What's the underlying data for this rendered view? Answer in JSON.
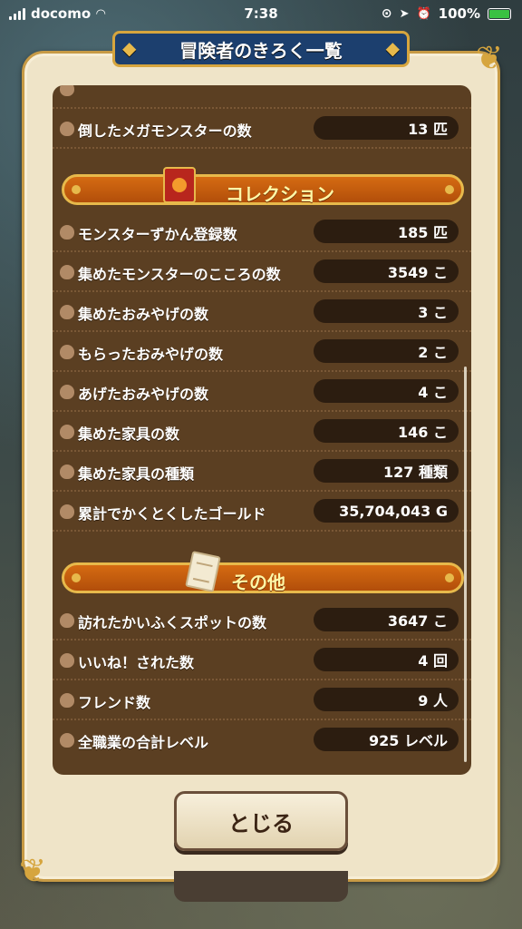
{
  "status_bar": {
    "carrier": "docomo",
    "time": "7:38",
    "battery": "100%"
  },
  "title": "冒険者のきろく一覧",
  "rows_top": [
    {
      "label": "倒したメガモンスターの数",
      "value": "13 匹"
    }
  ],
  "sections": [
    {
      "title": "コレクション",
      "icon": "book-icon",
      "rows": [
        {
          "label": "モンスターずかん登録数",
          "value": "185 匹"
        },
        {
          "label": "集めたモンスターのこころの数",
          "value": "3549 こ"
        },
        {
          "label": "集めたおみやげの数",
          "value": "3 こ"
        },
        {
          "label": "もらったおみやげの数",
          "value": "2 こ"
        },
        {
          "label": "あげたおみやげの数",
          "value": "4 こ"
        },
        {
          "label": "集めた家具の数",
          "value": "146 こ"
        },
        {
          "label": "集めた家具の種類",
          "value": "127 種類"
        },
        {
          "label": "累計でかくとくしたゴールド",
          "value": "35,704,043 G"
        }
      ]
    },
    {
      "title": "その他",
      "icon": "scroll-icon",
      "rows": [
        {
          "label": "訪れたかいふくスポットの数",
          "value": "3647 こ"
        },
        {
          "label": "いいね！された数",
          "value": "4 回"
        },
        {
          "label": "フレンド数",
          "value": "9 人"
        },
        {
          "label": "全職業の合計レベル",
          "value": "925 レベル"
        }
      ]
    }
  ],
  "close_button": "とじる",
  "colors": {
    "panel_bg": "#efe4c8",
    "list_bg": "#5b3f22",
    "section_orange": "#d56b12",
    "gold": "#e7b94b",
    "title_blue": "#1c3f6e"
  }
}
